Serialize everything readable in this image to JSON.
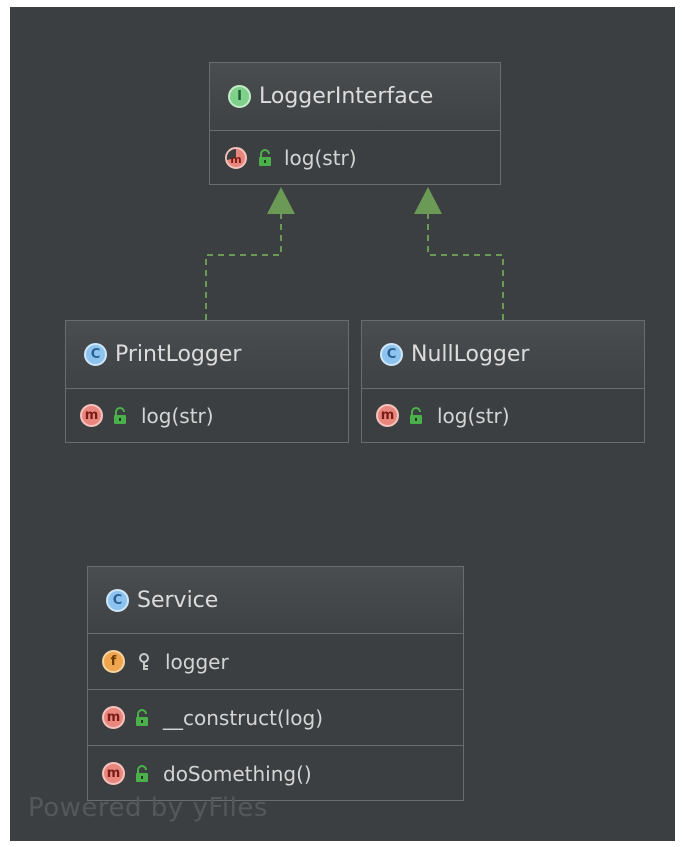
{
  "nodes": {
    "logger_interface": {
      "kind": "interface",
      "kind_letter": "I",
      "name": "LoggerInterface",
      "methods": [
        {
          "name": "log(str)",
          "visibility": "public",
          "icon": "abstract-method-icon"
        }
      ]
    },
    "print_logger": {
      "kind": "class",
      "kind_letter": "C",
      "name": "PrintLogger",
      "methods": [
        {
          "letter": "m",
          "name": "log(str)",
          "visibility": "public"
        }
      ]
    },
    "null_logger": {
      "kind": "class",
      "kind_letter": "C",
      "name": "NullLogger",
      "methods": [
        {
          "letter": "m",
          "name": "log(str)",
          "visibility": "public"
        }
      ]
    },
    "service": {
      "kind": "class",
      "kind_letter": "C",
      "name": "Service",
      "fields": [
        {
          "letter": "f",
          "name": "logger",
          "visibility": "private"
        }
      ],
      "methods": [
        {
          "letter": "m",
          "name": "__construct(log)",
          "visibility": "public"
        },
        {
          "letter": "m",
          "name": "doSomething()",
          "visibility": "public"
        }
      ]
    }
  },
  "edges": [
    {
      "from": "print_logger",
      "to": "logger_interface",
      "type": "realization"
    },
    {
      "from": "null_logger",
      "to": "logger_interface",
      "type": "realization"
    }
  ],
  "watermark": "Powered by yFiles",
  "colors": {
    "background": "#3c3f41",
    "edge": "#6a9a55",
    "public_lock": "#4bb04a"
  }
}
